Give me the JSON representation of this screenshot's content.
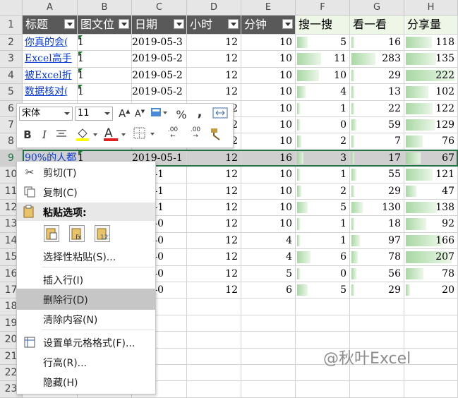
{
  "columns": [
    "A",
    "B",
    "C",
    "D",
    "E",
    "F",
    "G",
    "H"
  ],
  "header_row": [
    "标题",
    "图文位",
    "日期",
    "小时",
    "分钟",
    "搜一搜",
    "看一看",
    "分享量"
  ],
  "rows": [
    {
      "n": "2",
      "a": "你真的会(",
      "b": "1",
      "c": "2019-05-3",
      "d": "12",
      "e": "10",
      "f": "5",
      "g": "16",
      "h": "118"
    },
    {
      "n": "3",
      "a": "Excel高手",
      "b": "1",
      "c": "2019-05-2",
      "d": "12",
      "e": "10",
      "f": "11",
      "g": "283",
      "h": "135"
    },
    {
      "n": "4",
      "a": "被Excel折",
      "b": "1",
      "c": "2019-05-2",
      "d": "12",
      "e": "10",
      "f": "10",
      "g": "29",
      "h": "222"
    },
    {
      "n": "5",
      "a": "数据核对(",
      "b": "1",
      "c": "2019-05-2",
      "d": "12",
      "e": "10",
      "f": "4",
      "g": "13",
      "h": "102"
    },
    {
      "n": "6",
      "a": "",
      "b": "",
      "c": "",
      "d": "12",
      "e": "10",
      "f": "1",
      "g": "22",
      "h": "122"
    },
    {
      "n": "7",
      "a": "",
      "b": "",
      "c": "",
      "d": "12",
      "e": "10",
      "f": "0",
      "g": "59",
      "h": "129"
    },
    {
      "n": "8",
      "a": "",
      "b": "",
      "c": "",
      "d": "12",
      "e": "10",
      "f": "2",
      "g": "7",
      "h": "76"
    },
    {
      "n": "9",
      "a": "90%的人都",
      "b": "1",
      "c": "2019-05-1",
      "d": "12",
      "e": "16",
      "f": "3",
      "g": "17",
      "h": "67"
    },
    {
      "n": "10",
      "a": "",
      "b": "",
      "c": "9-05-1",
      "d": "12",
      "e": "10",
      "f": "1",
      "g": "55",
      "h": "121"
    },
    {
      "n": "11",
      "a": "",
      "b": "",
      "c": "9-05-1",
      "d": "12",
      "e": "10",
      "f": "2",
      "g": "29",
      "h": "47"
    },
    {
      "n": "12",
      "a": "",
      "b": "",
      "c": "9-05-1",
      "d": "12",
      "e": "10",
      "f": "5",
      "g": "130",
      "h": "138"
    },
    {
      "n": "13",
      "a": "",
      "b": "",
      "c": "9-05-0",
      "d": "12",
      "e": "10",
      "f": "1",
      "g": "18",
      "h": "92"
    },
    {
      "n": "14",
      "a": "",
      "b": "",
      "c": "9-05-0",
      "d": "12",
      "e": "4",
      "f": "1",
      "g": "97",
      "h": "166"
    },
    {
      "n": "15",
      "a": "",
      "b": "",
      "c": "9-05-0",
      "d": "12",
      "e": "4",
      "f": "6",
      "g": "78",
      "h": "207"
    },
    {
      "n": "16",
      "a": "",
      "b": "",
      "c": "9-05-0",
      "d": "12",
      "e": "5",
      "f": "0",
      "g": "56",
      "h": "78"
    },
    {
      "n": "17",
      "a": "",
      "b": "",
      "c": "9-05-0",
      "d": "12",
      "e": "6",
      "f": "5",
      "g": "29",
      "h": "20"
    },
    {
      "n": "18",
      "a": "",
      "b": "",
      "c": "",
      "d": "",
      "e": "",
      "f": "",
      "g": "",
      "h": ""
    },
    {
      "n": "19",
      "a": "",
      "b": "",
      "c": "",
      "d": "",
      "e": "",
      "f": "",
      "g": "",
      "h": ""
    },
    {
      "n": "20",
      "a": "",
      "b": "",
      "c": "",
      "d": "",
      "e": "",
      "f": "",
      "g": "",
      "h": ""
    },
    {
      "n": "21",
      "a": "",
      "b": "",
      "c": "",
      "d": "",
      "e": "",
      "f": "",
      "g": "",
      "h": ""
    },
    {
      "n": "22",
      "a": "",
      "b": "",
      "c": "",
      "d": "",
      "e": "",
      "f": "",
      "g": "",
      "h": ""
    },
    {
      "n": "23",
      "a": "",
      "b": "",
      "c": "",
      "d": "",
      "e": "",
      "f": "",
      "g": "",
      "h": ""
    }
  ],
  "row1_label": "1",
  "selected_row": "9",
  "mini_toolbar": {
    "font_name": "宋体",
    "font_size": "11",
    "grow_font": "A",
    "shrink_font": "A",
    "percent": "%",
    "comma": ",",
    "bold": "B",
    "italic": "I",
    "font_color": "A",
    "inc_decimal": ".00",
    "dec_decimal": ".00"
  },
  "context_menu": {
    "cut": "剪切(T)",
    "copy": "复制(C)",
    "paste_options": "粘贴选项:",
    "paste_special": "选择性粘贴(S)...",
    "insert_row": "插入行(I)",
    "delete_row": "删除行(D)",
    "clear_content": "清除内容(N)",
    "format_cells": "设置单元格格式(F)...",
    "row_height": "行高(R)...",
    "hide": "隐藏(H)"
  },
  "watermark": "@秋叶Excel",
  "colors": {
    "header_dark": "#595959",
    "header_light": "#eef6e8",
    "databar": "#9fd39a",
    "link": "#0b3bd6",
    "selection": "#217346"
  }
}
